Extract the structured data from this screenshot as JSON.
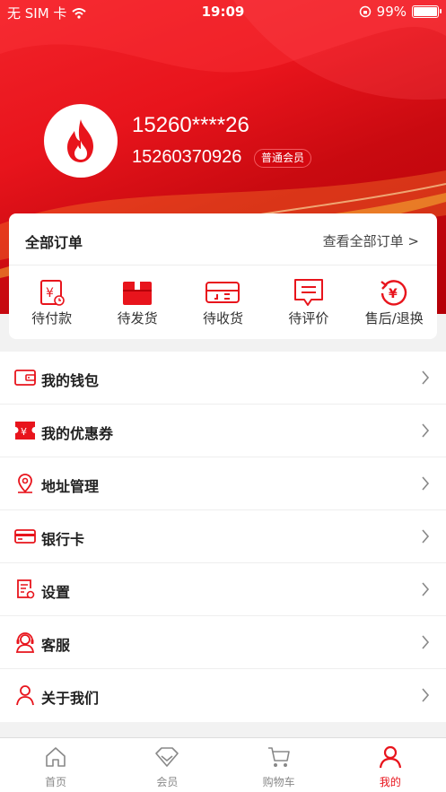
{
  "status_bar": {
    "carrier": "无 SIM 卡",
    "time": "19:09",
    "battery": "99%"
  },
  "profile": {
    "nickname": "15260****26",
    "phone": "15260370926",
    "level": "普通会员",
    "avatar_icon": "flame-icon"
  },
  "orders": {
    "title": "全部订单",
    "view_all": "查看全部订单 >",
    "items": [
      {
        "label": "待付款",
        "icon": "payment-icon"
      },
      {
        "label": "待发货",
        "icon": "package-icon"
      },
      {
        "label": "待收货",
        "icon": "delivery-icon"
      },
      {
        "label": "待评价",
        "icon": "review-icon"
      },
      {
        "label": "售后/退换",
        "icon": "refund-icon"
      }
    ]
  },
  "menu": [
    {
      "label": "我的钱包",
      "icon": "wallet-icon"
    },
    {
      "label": "我的优惠券",
      "icon": "coupon-icon"
    },
    {
      "label": "地址管理",
      "icon": "location-icon"
    },
    {
      "label": "银行卡",
      "icon": "bank-card-icon"
    },
    {
      "label": "设置",
      "icon": "settings-icon"
    },
    {
      "label": "客服",
      "icon": "customer-service-icon"
    },
    {
      "label": "关于我们",
      "icon": "about-icon"
    }
  ],
  "tabbar": [
    {
      "label": "首页",
      "icon": "home-icon",
      "active": false
    },
    {
      "label": "会员",
      "icon": "diamond-icon",
      "active": false
    },
    {
      "label": "购物车",
      "icon": "cart-icon",
      "active": false
    },
    {
      "label": "我的",
      "icon": "user-icon",
      "active": true
    }
  ],
  "colors": {
    "brand": "#e8141c",
    "accent_dark": "#b50008",
    "text": "#222222"
  }
}
